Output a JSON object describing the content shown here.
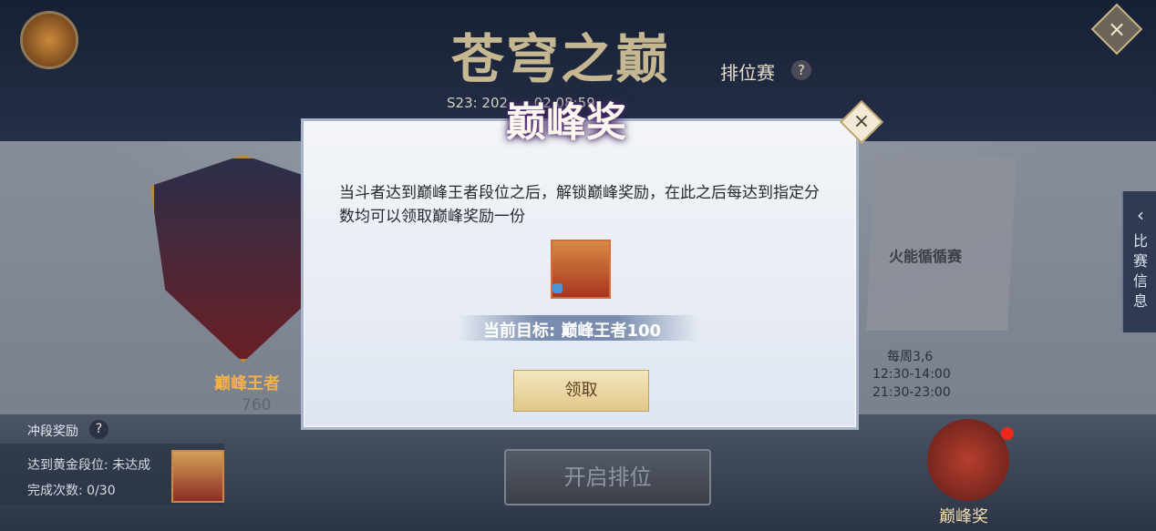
{
  "header": {
    "title": "苍穹之巅",
    "subtitle": "排位赛",
    "season": "S23: 202 ... .02 08:59"
  },
  "left_rank": {
    "rank_name": "巅峰王者",
    "score": "760"
  },
  "event": {
    "name": "火能循循赛",
    "schedule_day": "每周3,6",
    "time_slots": [
      "12:30-14:00",
      "21:30-23:00"
    ]
  },
  "side_tab": {
    "label": "比赛信息"
  },
  "rush_reward": {
    "title": "冲段奖励",
    "condition": "达到黄金段位: 未达成",
    "completed": "完成次数: 0/30"
  },
  "main_button": {
    "label": "开启排位"
  },
  "peak_reward_entry": {
    "label": "巅峰奖"
  },
  "modal": {
    "title": "巅峰奖",
    "description": "当斗者达到巅峰王者段位之后，解锁巅峰奖励，在此之后每达到指定分数均可以领取巅峰奖励一份",
    "target": "当前目标: 巅峰王者100",
    "claim_button": "领取"
  },
  "icons": {
    "chest": "treasure-chest-icon",
    "close": "close-icon",
    "help": "help-icon",
    "lock": "lock-icon",
    "arrow": "chevron-left-icon"
  },
  "colors": {
    "accent_gold": "#d7b56d",
    "accent_blue": "#6e82a7",
    "notification_red": "#ec2a1c"
  }
}
